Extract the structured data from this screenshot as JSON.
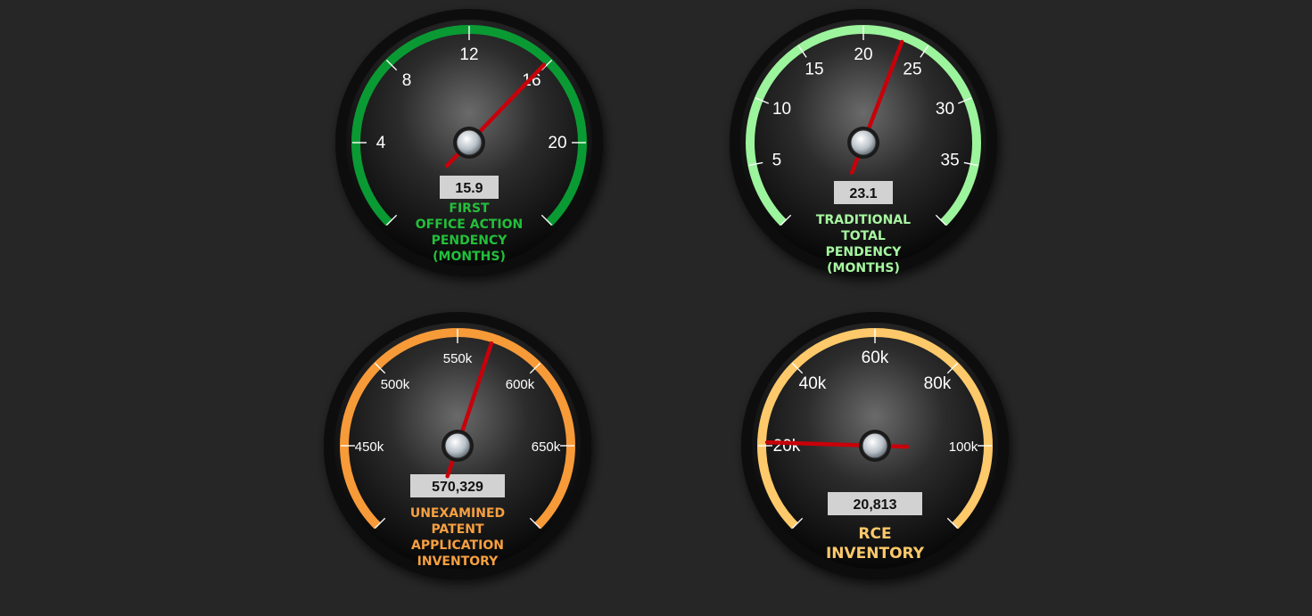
{
  "gauges": [
    {
      "id": "first-action",
      "value_text": "15.9",
      "value": 15.9,
      "min": 0,
      "max": 24,
      "tick_step": 4,
      "labels": [
        "4",
        "8",
        "12",
        "16",
        "20"
      ],
      "label_values": [
        4,
        8,
        12,
        16,
        20
      ],
      "caption": [
        "FIRST",
        "OFFICE ACTION",
        "PENDENCY",
        "(MONTHS)"
      ],
      "accent": "#0a9a33",
      "caption_color": "#22c03a"
    },
    {
      "id": "total-pendency",
      "value_text": "23.1",
      "value": 23.1,
      "min": 0,
      "max": 40,
      "tick_step": 5,
      "labels": [
        "5",
        "10",
        "15",
        "20",
        "25",
        "30",
        "35"
      ],
      "label_values": [
        5,
        10,
        15,
        20,
        25,
        30,
        35
      ],
      "caption": [
        "TRADITIONAL",
        "TOTAL",
        "PENDENCY",
        "(MONTHS)"
      ],
      "accent": "#9cf49c",
      "caption_color": "#a6f6a0"
    },
    {
      "id": "unexamined",
      "value_text": "570,329",
      "value": 570329,
      "min": 400000,
      "max": 700000,
      "tick_step": 50000,
      "labels": [
        "450k",
        "500k",
        "550k",
        "600k",
        "650k"
      ],
      "label_values": [
        450000,
        500000,
        550000,
        600000,
        650000
      ],
      "caption": [
        "UNEXAMINED",
        "PATENT",
        "APPLICATION",
        "INVENTORY"
      ],
      "accent": "#f79a38",
      "caption_color": "#f7a040"
    },
    {
      "id": "rce",
      "value_text": "20,813",
      "value": 20813,
      "min": 0,
      "max": 120000,
      "tick_step": 20000,
      "labels": [
        "20k",
        "40k",
        "60k",
        "80k",
        "100k"
      ],
      "label_values": [
        20000,
        40000,
        60000,
        80000,
        100000
      ],
      "caption": [
        "RCE",
        "INVENTORY"
      ],
      "accent": "#fdc96a",
      "caption_color": "#fdc96a"
    }
  ]
}
